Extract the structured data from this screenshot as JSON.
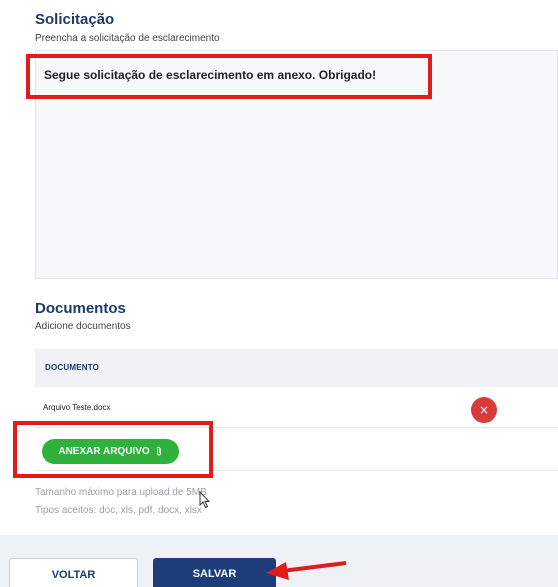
{
  "solicitacao": {
    "title": "Solicitação",
    "subtitle": "Preencha a solicitação de esclarecimento",
    "text_value": "Segue solicitação de esclarecimento em anexo. Obrigado!"
  },
  "documentos": {
    "title": "Documentos",
    "subtitle": "Adicione documentos",
    "table": {
      "column_header": "DOCUMENTO",
      "rows": [
        {
          "file_name": "Arquivo Teste.docx"
        }
      ]
    },
    "remove_icon": "×",
    "attach_button_label": "ANEXAR ARQUIVO",
    "attach_icon": "paperclip-icon",
    "max_size_hint": "Tamanho máximo para upload de 5MB",
    "accepted_types_hint": "Tipos aceitos: doc, xls, pdf, docx, xlsx"
  },
  "footer": {
    "back_label": "VOLTAR",
    "save_label": "SALVAR"
  },
  "colors": {
    "brand_blue": "#1c3d7a",
    "title_blue": "#1e3a6b",
    "success_green": "#2fb23b",
    "danger_red": "#d93a3a",
    "annotation_red": "#e21b1b"
  }
}
